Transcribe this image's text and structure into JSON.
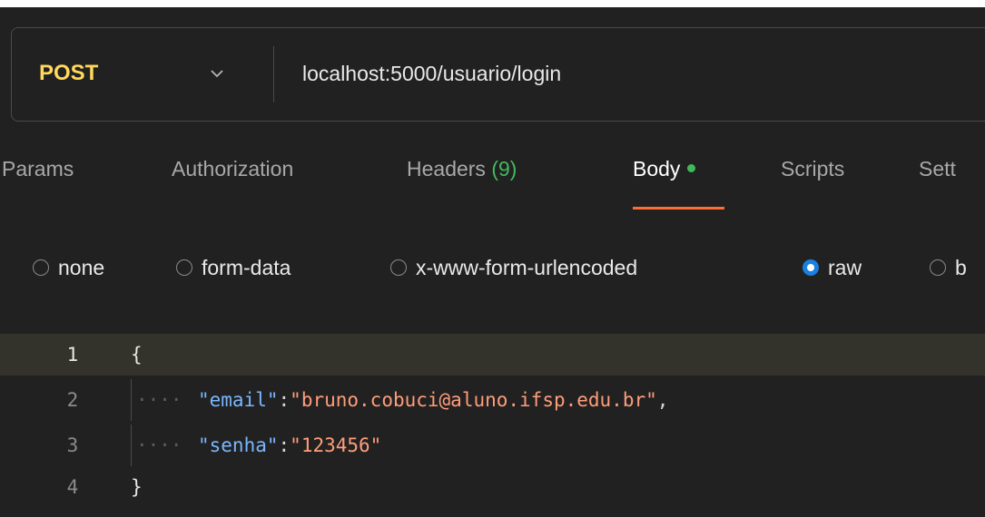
{
  "request": {
    "method": "POST",
    "url": "localhost:5000/usuario/login"
  },
  "tabs": [
    {
      "label": "Params"
    },
    {
      "label": "Authorization"
    },
    {
      "label": "Headers",
      "count": "(9)"
    },
    {
      "label": "Body",
      "active": true
    },
    {
      "label": "Scripts"
    },
    {
      "label": "Sett"
    }
  ],
  "body_types": [
    {
      "label": "none",
      "checked": false
    },
    {
      "label": "form-data",
      "checked": false
    },
    {
      "label": "x-www-form-urlencoded",
      "checked": false
    },
    {
      "label": "raw",
      "checked": true
    },
    {
      "label": "b",
      "checked": false
    }
  ],
  "editor": {
    "lines": [
      {
        "number": "1",
        "brace": "{"
      },
      {
        "number": "2",
        "key": "\"email\"",
        "colon": ":",
        "value": "\"bruno.cobuci@aluno.ifsp.edu.br\"",
        "comma": ","
      },
      {
        "number": "3",
        "key": "\"senha\"",
        "colon": ":",
        "value": "\"123456\""
      },
      {
        "number": "4",
        "brace": "}"
      }
    ]
  },
  "colors": {
    "background": "#212121",
    "method": "#ffd85c",
    "accent_underline": "#ff6c37",
    "dot_green": "#3fb858",
    "radio_checked": "#1a7fe0",
    "json_key": "#7ab7ff",
    "json_string": "#ff9d7a"
  },
  "icons": {
    "method_dropdown": "chevron-down-icon",
    "body_status": "green-dot-icon"
  }
}
